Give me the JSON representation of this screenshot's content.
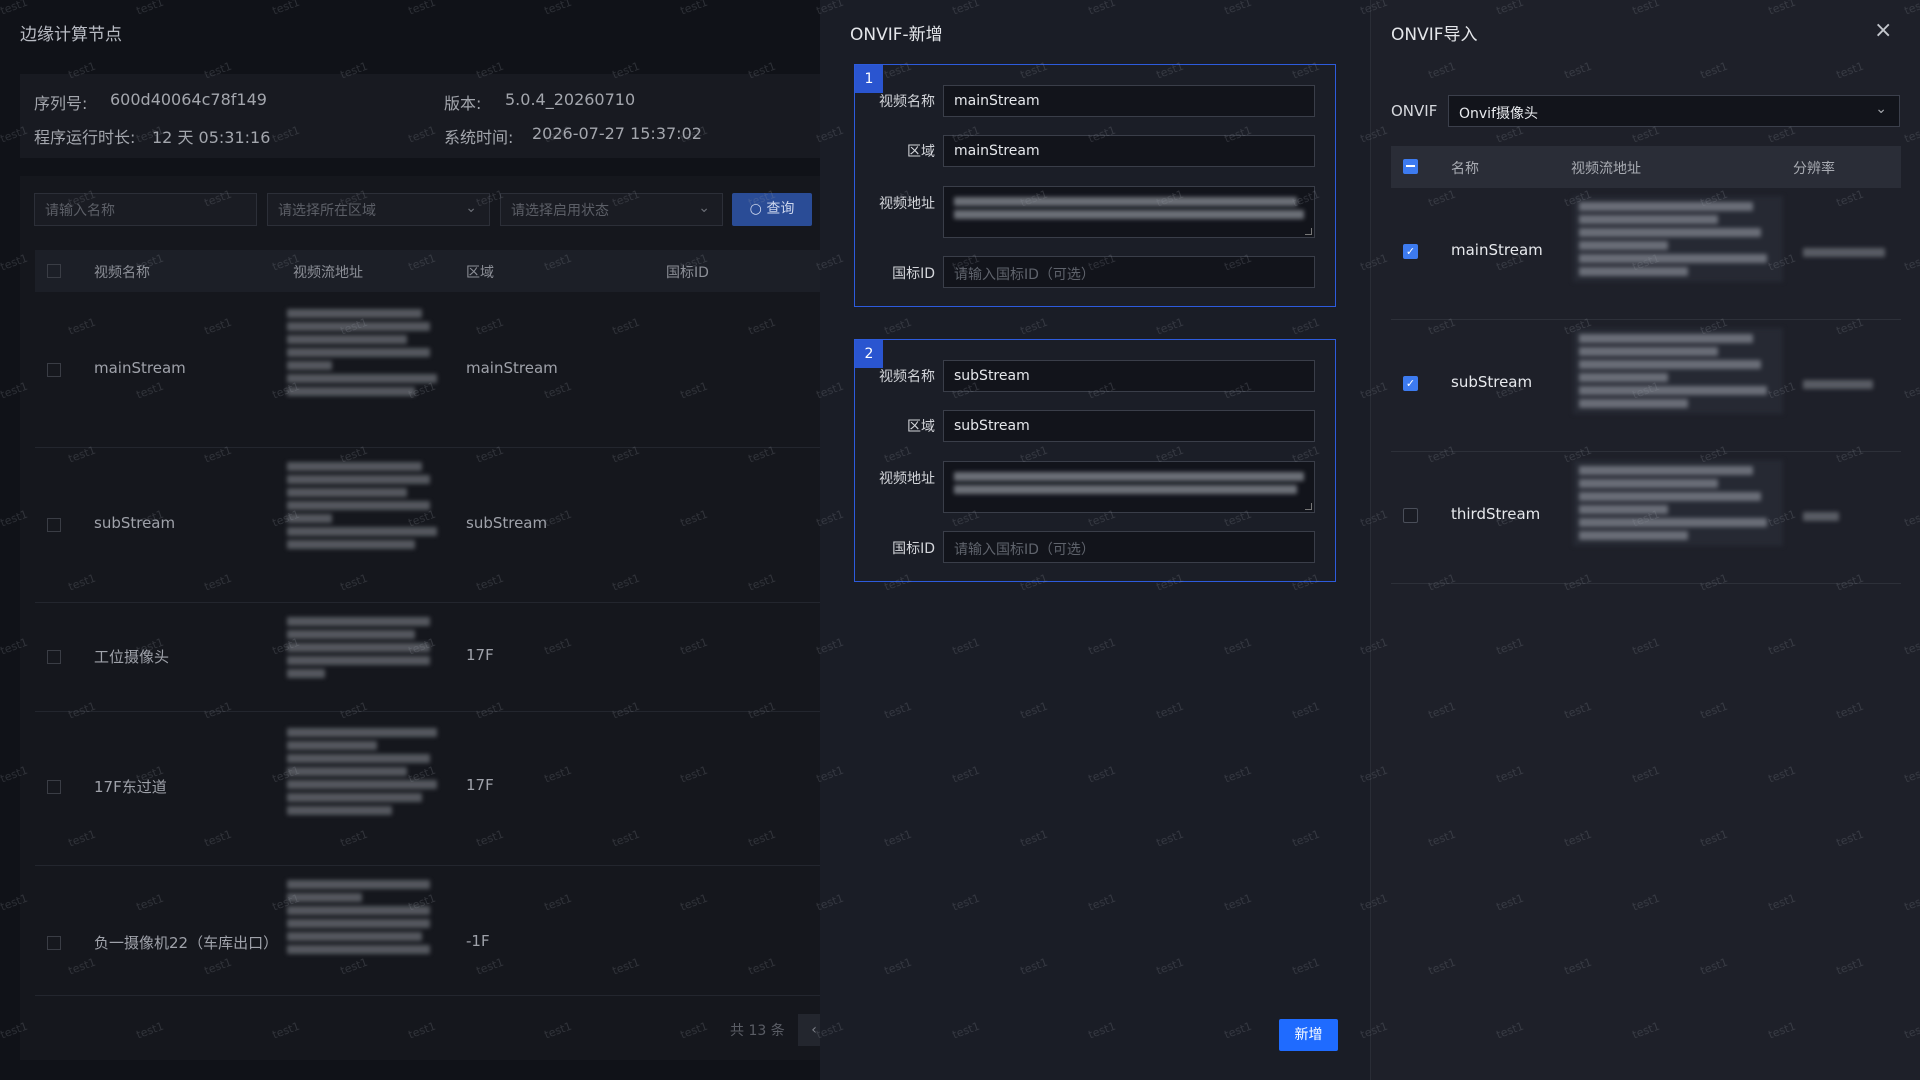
{
  "background_page": {
    "title": "边缘计算节点",
    "info": {
      "serial_label": "序列号:",
      "serial": "600d40064c78f149",
      "version_label": "版本:",
      "version": "5.0.4_20260710",
      "uptime_label": "程序运行时长:",
      "uptime": "12 天 05:31:16",
      "systime_label": "系统时间:",
      "systime": "2026-07-27 15:37:02"
    },
    "filters": {
      "name_placeholder": "请输入名称",
      "area_placeholder": "请选择所在区域",
      "status_placeholder": "请选择启用状态",
      "query_label": "查询"
    },
    "columns": [
      "视频名称",
      "视频流地址",
      "区域",
      "国标ID"
    ],
    "rows": [
      {
        "name": "mainStream",
        "area": "mainStream"
      },
      {
        "name": "subStream",
        "area": "subStream"
      },
      {
        "name": "工位摄像头",
        "area": "17F"
      },
      {
        "name": "17F东过道",
        "area": "17F"
      },
      {
        "name": "负一摄像机22（车库出口）",
        "area": "-1F"
      }
    ],
    "pagination": {
      "total_text": "共 13 条",
      "prev": "‹"
    }
  },
  "add_dialog": {
    "title": "ONVIF-新增",
    "labels": {
      "name": "视频名称",
      "area": "区域",
      "url": "视频地址",
      "gbid": "国标ID"
    },
    "gbid_placeholder": "请输入国标ID（可选）",
    "groups": [
      {
        "index": "1",
        "name": "mainStream",
        "area": "mainStream"
      },
      {
        "index": "2",
        "name": "subStream",
        "area": "subStream"
      }
    ],
    "submit_label": "新增"
  },
  "import_dialog": {
    "title": "ONVIF导入",
    "close_icon": "×",
    "onvif_label": "ONVIF",
    "onvif_selected": "Onvif摄像头",
    "columns": {
      "name": "名称",
      "url": "视频流地址",
      "resolution": "分辨率"
    },
    "rows": [
      {
        "name": "mainStream",
        "checked": true
      },
      {
        "name": "subStream",
        "checked": true
      },
      {
        "name": "thirdStream",
        "checked": false
      }
    ]
  },
  "watermark_text": "test1",
  "colors": {
    "accent": "#1f6bff",
    "group_border": "#2d5bdc",
    "checkbox_on": "#3d7bf0"
  }
}
